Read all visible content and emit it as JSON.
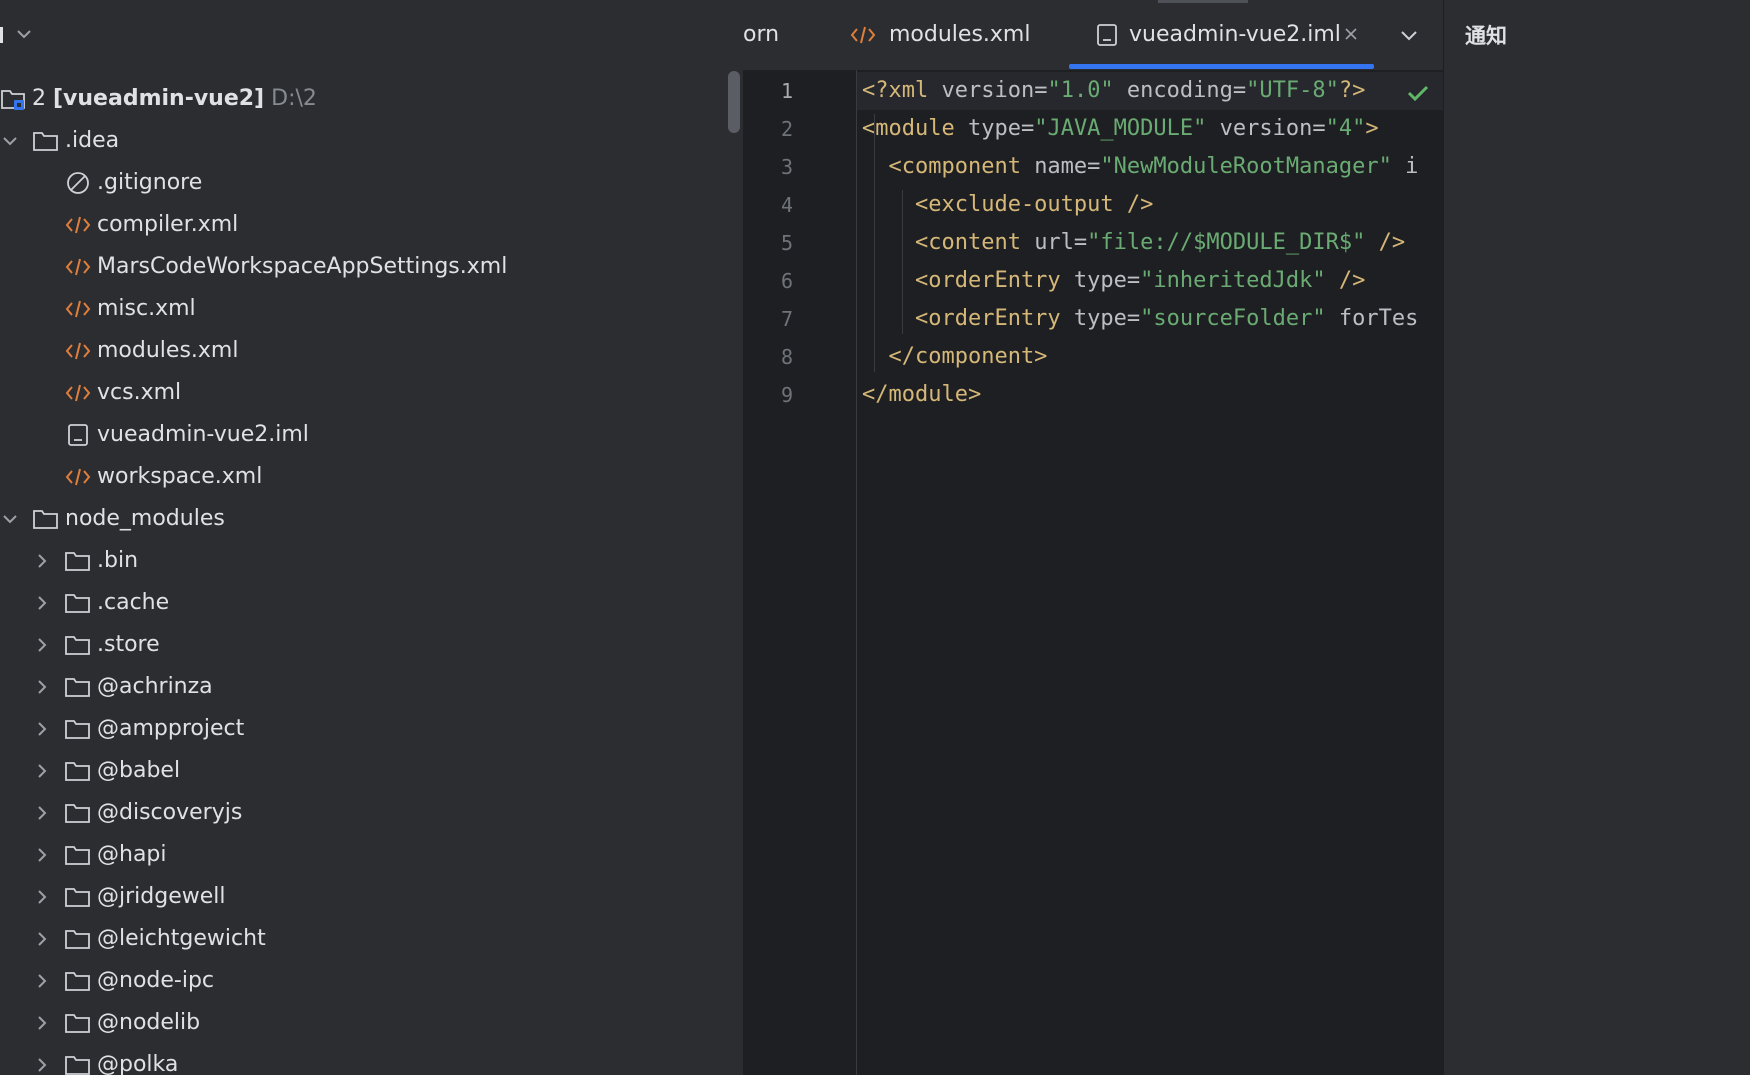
{
  "project_panel": {
    "root": {
      "name": "2",
      "module": "[vueadmin-vue2]",
      "path": "D:\\2"
    },
    "items": [
      {
        "label": ".idea",
        "kind": "folder",
        "expanded": true,
        "level": 0
      },
      {
        "label": ".gitignore",
        "kind": "ignore",
        "level": 1
      },
      {
        "label": "compiler.xml",
        "kind": "xml",
        "level": 1
      },
      {
        "label": "MarsCodeWorkspaceAppSettings.xml",
        "kind": "xml",
        "level": 1
      },
      {
        "label": "misc.xml",
        "kind": "xml",
        "level": 1
      },
      {
        "label": "modules.xml",
        "kind": "xml",
        "level": 1
      },
      {
        "label": "vcs.xml",
        "kind": "xml",
        "level": 1
      },
      {
        "label": "vueadmin-vue2.iml",
        "kind": "iml",
        "level": 1
      },
      {
        "label": "workspace.xml",
        "kind": "xml",
        "level": 1
      },
      {
        "label": "node_modules",
        "kind": "folder",
        "expanded": true,
        "level": 0
      },
      {
        "label": ".bin",
        "kind": "folder",
        "expanded": false,
        "level": 1
      },
      {
        "label": ".cache",
        "kind": "folder",
        "expanded": false,
        "level": 1
      },
      {
        "label": ".store",
        "kind": "folder",
        "expanded": false,
        "level": 1
      },
      {
        "label": "@achrinza",
        "kind": "folder",
        "expanded": false,
        "level": 1
      },
      {
        "label": "@ampproject",
        "kind": "folder",
        "expanded": false,
        "level": 1
      },
      {
        "label": "@babel",
        "kind": "folder",
        "expanded": false,
        "level": 1
      },
      {
        "label": "@discoveryjs",
        "kind": "folder",
        "expanded": false,
        "level": 1
      },
      {
        "label": "@hapi",
        "kind": "folder",
        "expanded": false,
        "level": 1
      },
      {
        "label": "@jridgewell",
        "kind": "folder",
        "expanded": false,
        "level": 1
      },
      {
        "label": "@leichtgewicht",
        "kind": "folder",
        "expanded": false,
        "level": 1
      },
      {
        "label": "@node-ipc",
        "kind": "folder",
        "expanded": false,
        "level": 1
      },
      {
        "label": "@nodelib",
        "kind": "folder",
        "expanded": false,
        "level": 1
      },
      {
        "label": "@polka",
        "kind": "folder",
        "expanded": false,
        "level": 1
      }
    ]
  },
  "editor": {
    "tabs": [
      {
        "label": "orn",
        "icon": "none"
      },
      {
        "label": "modules.xml",
        "icon": "xml-file-icon"
      },
      {
        "label": "vueadmin-vue2.iml",
        "icon": "iml-file-icon",
        "active": true
      }
    ],
    "lines": [
      [
        {
          "t": "tag",
          "s": "<?xml "
        },
        {
          "t": "attr",
          "s": "version="
        },
        {
          "t": "str",
          "s": "\"1.0\""
        },
        {
          "t": "attr",
          "s": " encoding="
        },
        {
          "t": "str",
          "s": "\"UTF-8\""
        },
        {
          "t": "tag",
          "s": "?>"
        }
      ],
      [
        {
          "t": "tag",
          "s": "<module "
        },
        {
          "t": "attr",
          "s": "type="
        },
        {
          "t": "str",
          "s": "\"JAVA_MODULE\""
        },
        {
          "t": "attr",
          "s": " version="
        },
        {
          "t": "str",
          "s": "\"4\""
        },
        {
          "t": "tag",
          "s": ">"
        }
      ],
      [
        {
          "t": "tag",
          "s": "  <component "
        },
        {
          "t": "attr",
          "s": "name="
        },
        {
          "t": "str",
          "s": "\"NewModuleRootManager\""
        },
        {
          "t": "attr",
          "s": " i"
        }
      ],
      [
        {
          "t": "tag",
          "s": "    <exclude-output />"
        }
      ],
      [
        {
          "t": "tag",
          "s": "    <content "
        },
        {
          "t": "attr",
          "s": "url="
        },
        {
          "t": "str",
          "s": "\"file://$MODULE_DIR$\""
        },
        {
          "t": "tag",
          "s": " />"
        }
      ],
      [
        {
          "t": "tag",
          "s": "    <orderEntry "
        },
        {
          "t": "attr",
          "s": "type="
        },
        {
          "t": "str",
          "s": "\"inheritedJdk\""
        },
        {
          "t": "tag",
          "s": " />"
        }
      ],
      [
        {
          "t": "tag",
          "s": "    <orderEntry "
        },
        {
          "t": "attr",
          "s": "type="
        },
        {
          "t": "str",
          "s": "\"sourceFolder\""
        },
        {
          "t": "attr",
          "s": " forTes"
        }
      ],
      [
        {
          "t": "tag",
          "s": "  </component>"
        }
      ],
      [
        {
          "t": "tag",
          "s": "</module>"
        }
      ]
    ],
    "current_line": 1
  },
  "notifications": {
    "title": "通知"
  },
  "colors": {
    "accent": "#3574f0",
    "xml_icon": "#e07e3c",
    "tag": "#d5b778",
    "string": "#6aab73",
    "check": "#5fb865"
  }
}
